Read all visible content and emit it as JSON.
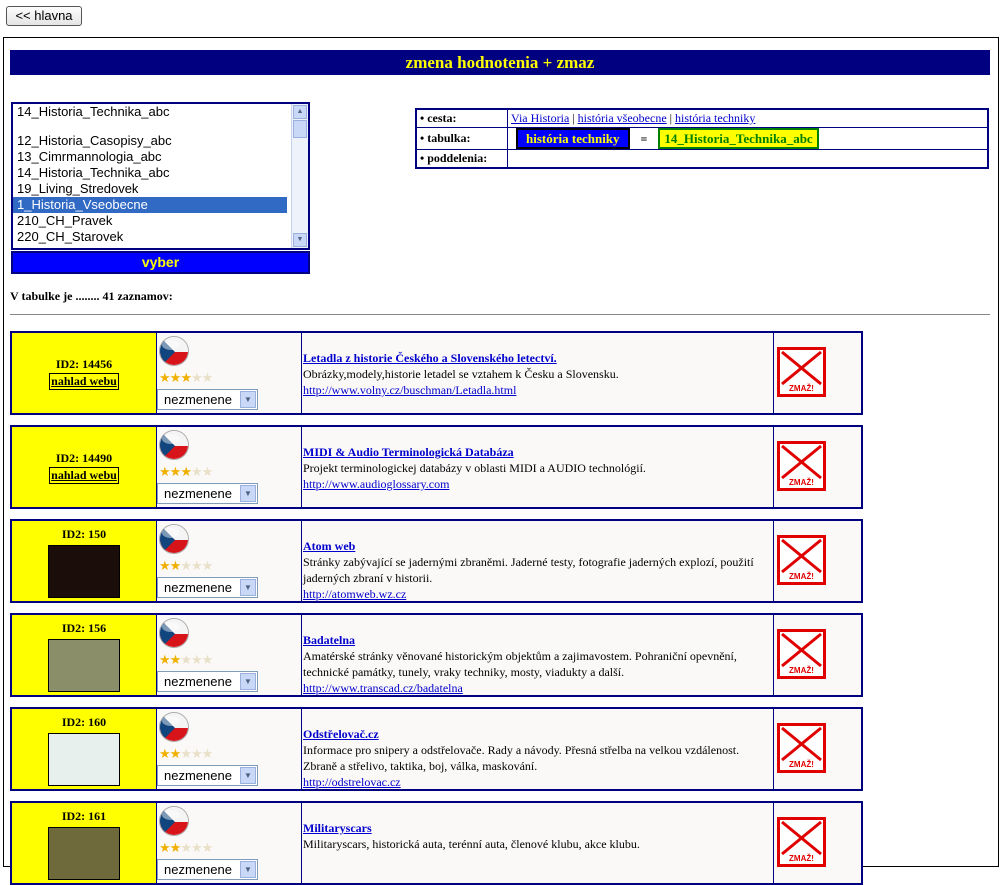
{
  "back_button": "<< hlavna",
  "page_title": "zmena hodnotenia + zmaz",
  "listbox": {
    "top_item": "14_Historia_Technika_abc",
    "items": [
      "12_Historia_Casopisy_abc",
      "13_Cimrmannologia_abc",
      "14_Historia_Technika_abc",
      "19_Living_Stredovek",
      "1_Historia_Vseobecne",
      "210_CH_Pravek",
      "220_CH_Starovek"
    ],
    "selected": "1_Historia_Vseobecne"
  },
  "vyber_label": "vyber",
  "info": {
    "cesta_label": "• cesta:",
    "cesta_links": [
      "Via Historia",
      "história všeobecne",
      "história techniky"
    ],
    "cesta_sep": "|",
    "tabulka_label": "• tabulka:",
    "tabulka_name": "história techniky",
    "tabulka_eq": "=",
    "tabulka_code": "14_Historia_Technika_abc",
    "poddelenia_label": "• poddelenia:",
    "poddelenia_value": ""
  },
  "count_text": "V tabulke je ........ 41 zaznamov:",
  "colors": {
    "title_bg": "#000080",
    "title_fg": "#ffff00",
    "id_cell_bg": "#ffff00",
    "delete": "#e00000"
  },
  "records": [
    {
      "id": "ID2: 14456",
      "preview_label": "nahlad webu",
      "has_thumb": false,
      "rating": 3,
      "select_value": "nezmenene",
      "title": "Letadla z historie Českého a Slovenského letectví.",
      "desc": "Obrázky,modely,historie letadel se vztahem k Česku a Slovensku.",
      "url": "http://www.volny.cz/buschman/Letadla.html",
      "delete_label": "ZMAŽ!"
    },
    {
      "id": "ID2: 14490",
      "preview_label": "nahlad webu",
      "has_thumb": false,
      "rating": 3,
      "select_value": "nezmenene",
      "title": "MIDI & Audio Terminologická Databáza",
      "desc": "Projekt terminologickej databázy v oblasti MIDI a AUDIO technológií.",
      "url": "http://www.audioglossary.com",
      "delete_label": "ZMAŽ!"
    },
    {
      "id": "ID2: 150",
      "preview_label": "",
      "has_thumb": true,
      "thumb_color": "#1a0d0a",
      "rating": 2,
      "select_value": "nezmenene",
      "title": "Atom web",
      "desc": "Stránky zabývající se jadernými zbraněmi. Jaderné testy, fotografie jaderných explozí, použití jaderných zbraní v historii.",
      "url": "http://atomweb.wz.cz",
      "delete_label": "ZMAŽ!"
    },
    {
      "id": "ID2: 156",
      "preview_label": "",
      "has_thumb": true,
      "thumb_color": "#8a8f6a",
      "rating": 2,
      "select_value": "nezmenene",
      "title": "Badatelna",
      "desc": "Amatérské stránky věnované historickým objektům a zajimavostem. Pohraniční opevnění, technické památky, tunely, vraky techniky, mosty, viadukty a další.",
      "url": "http://www.transcad.cz/badatelna",
      "delete_label": "ZMAŽ!"
    },
    {
      "id": "ID2: 160",
      "preview_label": "",
      "has_thumb": true,
      "thumb_color": "#e8f0ee",
      "rating": 2,
      "select_value": "nezmenene",
      "title": "Odstřelovač.cz",
      "desc": "Informace pro snipery a odstřelovače. Rady a návody. Přesná střelba na velkou vzdálenost. Zbraně a střelivo, taktika, boj, válka, maskování.",
      "url": "http://odstrelovac.cz",
      "delete_label": "ZMAŽ!"
    },
    {
      "id": "ID2: 161",
      "preview_label": "",
      "has_thumb": true,
      "thumb_color": "#6e6a3c",
      "rating": 2,
      "select_value": "nezmenene",
      "title": "Militaryscars",
      "desc": "Militaryscars, historická auta, terénní auta, členové klubu, akce klubu.",
      "url": "",
      "delete_label": "ZMAŽ!"
    }
  ]
}
